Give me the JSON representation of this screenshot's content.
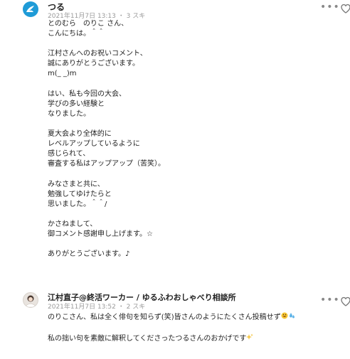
{
  "comments": [
    {
      "author": "つる",
      "date": "2021年11月7日 13:13",
      "likes": "3 スキ",
      "body": "とのむら　のりこ さん、\nこんにちは。＾＾\n\n江村さんへのお祝いコメント、\n誠にありがとうございます。\nm(_ _)m\n\nはい、私も今回の大会、\n学びの多い経験と\nなりました。\n\n夏大会より全体的に\nレベルアップしているように\n感じられて、\n審査する私はアップアップ（苦笑）。\n\nみなさまと共に、\n勉強してゆけたらと\n思いました。＾＾/\n\nかさねまして、\n御コメント感謝申し上げます。☆\n\nありがとうございます。♪",
      "more_icon": "more-dots-icon",
      "like_icon": "heart-icon",
      "avatar_color": "#1f9bd7"
    },
    {
      "author": "江村直子@終活ワーカー / ゆるふわおしゃべり相談所",
      "date": "2021年11月7日 13:52",
      "likes": "2 スキ",
      "body_line1": "のりこさん、私は全く俳句を知らず(笑)皆さんのようにたくさん投稿せず",
      "body_line2": "",
      "body_line3": "私の拙い句を素敵に解釈してくださったつるさんのおかげです",
      "more_icon": "more-dots-icon",
      "like_icon": "heart-icon"
    }
  ],
  "separator": "・"
}
